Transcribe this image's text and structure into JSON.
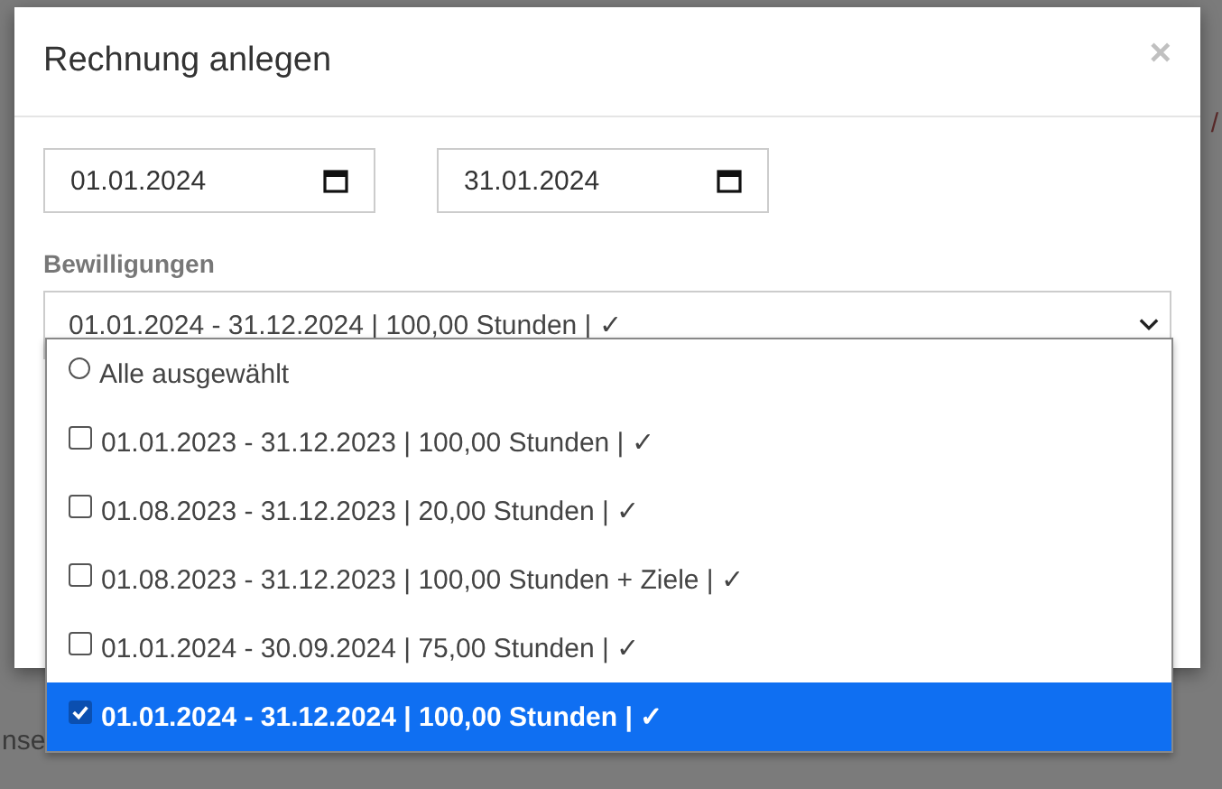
{
  "background": {
    "fragments": [
      "/",
      "nse"
    ]
  },
  "dialog": {
    "title": "Rechnung anlegen",
    "close": "×",
    "date_from": "01.01.2024",
    "date_to": "31.01.2024",
    "field_label": "Bewilligungen",
    "select_value": "01.01.2024 - 31.12.2024 | 100,00 Stunden | ✓",
    "options": [
      {
        "kind": "radio",
        "label": "Alle ausgewählt",
        "checked": false,
        "selected": false
      },
      {
        "kind": "checkbox",
        "label": "01.01.2023 - 31.12.2023 | 100,00 Stunden | ✓",
        "checked": false,
        "selected": false
      },
      {
        "kind": "checkbox",
        "label": "01.08.2023 - 31.12.2023 | 20,00 Stunden | ✓",
        "checked": false,
        "selected": false
      },
      {
        "kind": "checkbox",
        "label": "01.08.2023 - 31.12.2023 | 100,00 Stunden + Ziele | ✓",
        "checked": false,
        "selected": false
      },
      {
        "kind": "checkbox",
        "label": "01.01.2024 - 30.09.2024 | 75,00 Stunden | ✓",
        "checked": false,
        "selected": false
      },
      {
        "kind": "checkbox",
        "label": "01.01.2024 - 31.12.2024 | 100,00 Stunden | ✓",
        "checked": true,
        "selected": true
      }
    ]
  }
}
